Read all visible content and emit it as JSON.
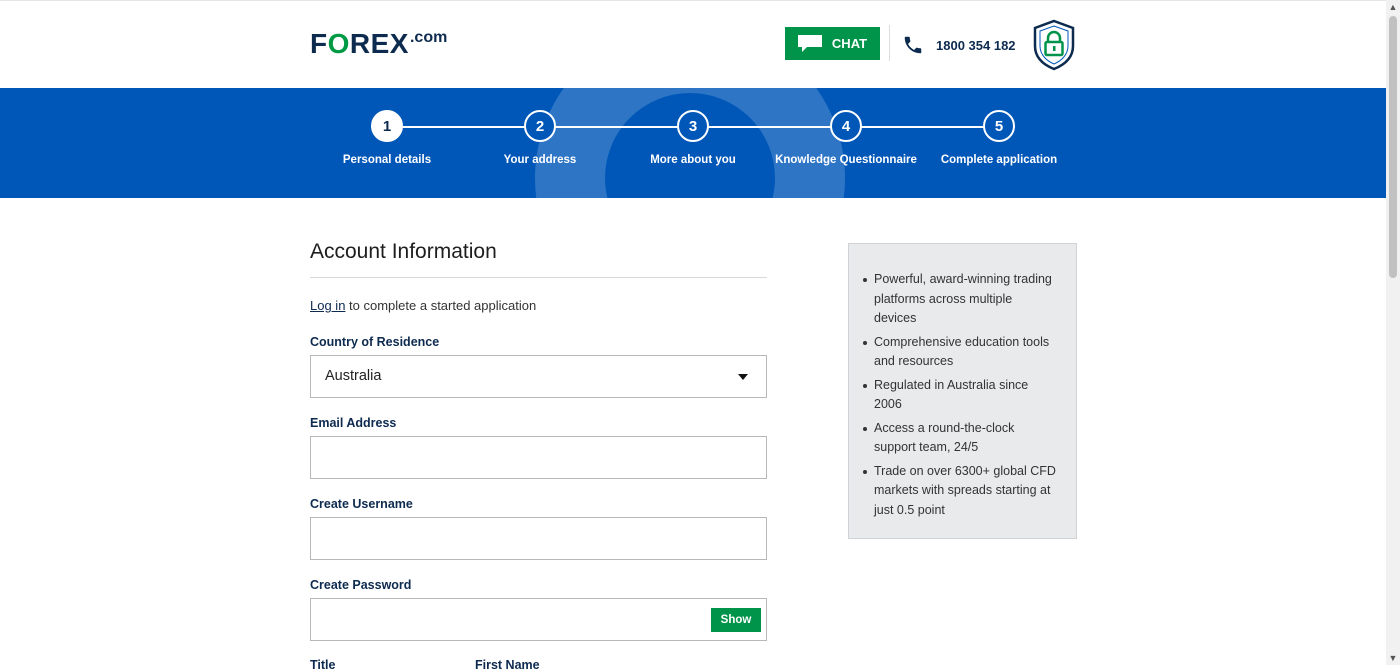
{
  "header": {
    "logo_main": "FOREX",
    "logo_suffix": ".com",
    "chat_label": "CHAT",
    "phone": "1800 354 182"
  },
  "stepper": {
    "steps": [
      {
        "number": "1",
        "label": "Personal details",
        "active": true
      },
      {
        "number": "2",
        "label": "Your address",
        "active": false
      },
      {
        "number": "3",
        "label": "More about you",
        "active": false
      },
      {
        "number": "4",
        "label": "Knowledge Questionnaire",
        "active": false
      },
      {
        "number": "5",
        "label": "Complete application",
        "active": false
      }
    ]
  },
  "form": {
    "title": "Account Information",
    "login_link": "Log in",
    "login_text": " to complete a started application",
    "country_label": "Country of Residence",
    "country_value": "Australia",
    "email_label": "Email Address",
    "email_value": "",
    "username_label": "Create Username",
    "username_value": "",
    "password_label": "Create Password",
    "password_value": "",
    "show_label": "Show",
    "title_label": "Title",
    "firstname_label": "First Name"
  },
  "benefits": {
    "items": [
      "Powerful, award-winning trading platforms across multiple devices",
      "Comprehensive education tools and resources",
      "Regulated in Australia since 2006",
      "Access a round-the-clock support team, 24/5",
      "Trade on over 6300+ global CFD markets with spreads starting at just 0.5 point"
    ]
  },
  "colors": {
    "brand_blue": "#0057b8",
    "brand_green": "#00934a",
    "navy": "#0d2a4f"
  },
  "icons": [
    "chat-bubble-icon",
    "phone-icon",
    "lock-shield-icon",
    "chevron-down-icon"
  ]
}
